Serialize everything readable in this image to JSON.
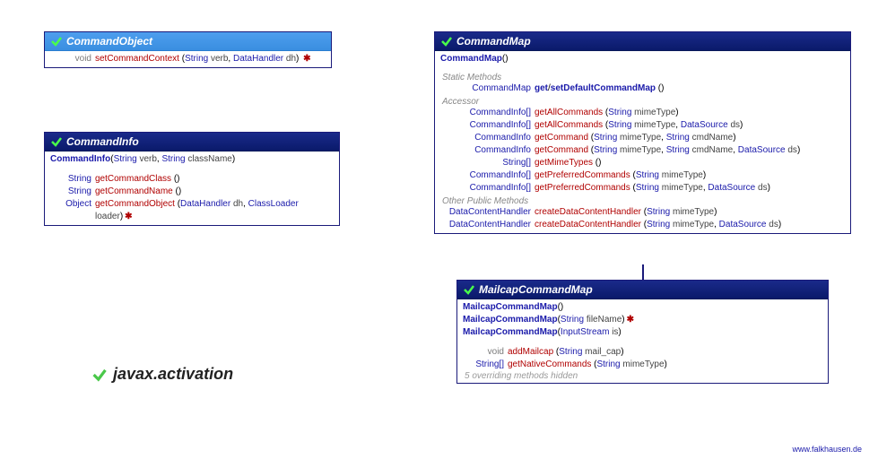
{
  "package": {
    "name": "javax.activation"
  },
  "footer": {
    "text": "www.falkhausen.de"
  },
  "commandObject": {
    "title": "CommandObject",
    "rows": [
      {
        "ret_kw": "void",
        "method": "setCommandContext",
        "params": [
          [
            "String",
            "verb"
          ],
          [
            "DataHandler",
            "dh"
          ]
        ],
        "throws": true
      }
    ]
  },
  "commandInfo": {
    "title": "CommandInfo",
    "ctor": {
      "name": "CommandInfo",
      "params": [
        [
          "String",
          "verb"
        ],
        [
          "String",
          "className"
        ]
      ]
    },
    "rows": [
      {
        "ret_type": "String",
        "method": "getCommandClass",
        "params": []
      },
      {
        "ret_type": "String",
        "method": "getCommandName",
        "params": []
      },
      {
        "ret_type": "Object",
        "method": "getCommandObject",
        "params": [
          [
            "DataHandler",
            "dh"
          ],
          [
            "ClassLoader",
            "loader"
          ]
        ],
        "throws": true
      }
    ]
  },
  "commandMap": {
    "title": "CommandMap",
    "ctor": {
      "name": "CommandMap",
      "params": []
    },
    "sections": {
      "static": "Static Methods",
      "accessor": "Accessor",
      "other": "Other Public Methods"
    },
    "static_rows": [
      {
        "ret_type": "CommandMap",
        "method_pair": [
          "get",
          "setDefaultCommandMap"
        ],
        "params": []
      }
    ],
    "accessor_rows": [
      {
        "ret_type": "CommandInfo[]",
        "method": "getAllCommands",
        "params": [
          [
            "String",
            "mimeType"
          ]
        ]
      },
      {
        "ret_type": "CommandInfo[]",
        "method": "getAllCommands",
        "params": [
          [
            "String",
            "mimeType"
          ],
          [
            "DataSource",
            "ds"
          ]
        ]
      },
      {
        "ret_type": "CommandInfo",
        "method": "getCommand",
        "params": [
          [
            "String",
            "mimeType"
          ],
          [
            "String",
            "cmdName"
          ]
        ]
      },
      {
        "ret_type": "CommandInfo",
        "method": "getCommand",
        "params": [
          [
            "String",
            "mimeType"
          ],
          [
            "String",
            "cmdName"
          ],
          [
            "DataSource",
            "ds"
          ]
        ]
      },
      {
        "ret_type": "String[]",
        "method": "getMimeTypes",
        "params": []
      },
      {
        "ret_type": "CommandInfo[]",
        "method": "getPreferredCommands",
        "params": [
          [
            "String",
            "mimeType"
          ]
        ]
      },
      {
        "ret_type": "CommandInfo[]",
        "method": "getPreferredCommands",
        "params": [
          [
            "String",
            "mimeType"
          ],
          [
            "DataSource",
            "ds"
          ]
        ]
      }
    ],
    "other_rows": [
      {
        "ret_type": "DataContentHandler",
        "method": "createDataContentHandler",
        "params": [
          [
            "String",
            "mimeType"
          ]
        ]
      },
      {
        "ret_type": "DataContentHandler",
        "method": "createDataContentHandler",
        "params": [
          [
            "String",
            "mimeType"
          ],
          [
            "DataSource",
            "ds"
          ]
        ]
      }
    ]
  },
  "mailcap": {
    "title": "MailcapCommandMap",
    "ctors": [
      {
        "name": "MailcapCommandMap",
        "params": []
      },
      {
        "name": "MailcapCommandMap",
        "params": [
          [
            "String",
            "fileName"
          ]
        ],
        "throws": true
      },
      {
        "name": "MailcapCommandMap",
        "params": [
          [
            "InputStream",
            "is"
          ]
        ]
      }
    ],
    "rows": [
      {
        "ret_kw": "void",
        "method": "addMailcap",
        "params": [
          [
            "String",
            "mail_cap"
          ]
        ]
      },
      {
        "ret_type": "String[]",
        "method": "getNativeCommands",
        "params": [
          [
            "String",
            "mimeType"
          ]
        ]
      }
    ],
    "hidden": "5 overriding methods hidden"
  }
}
